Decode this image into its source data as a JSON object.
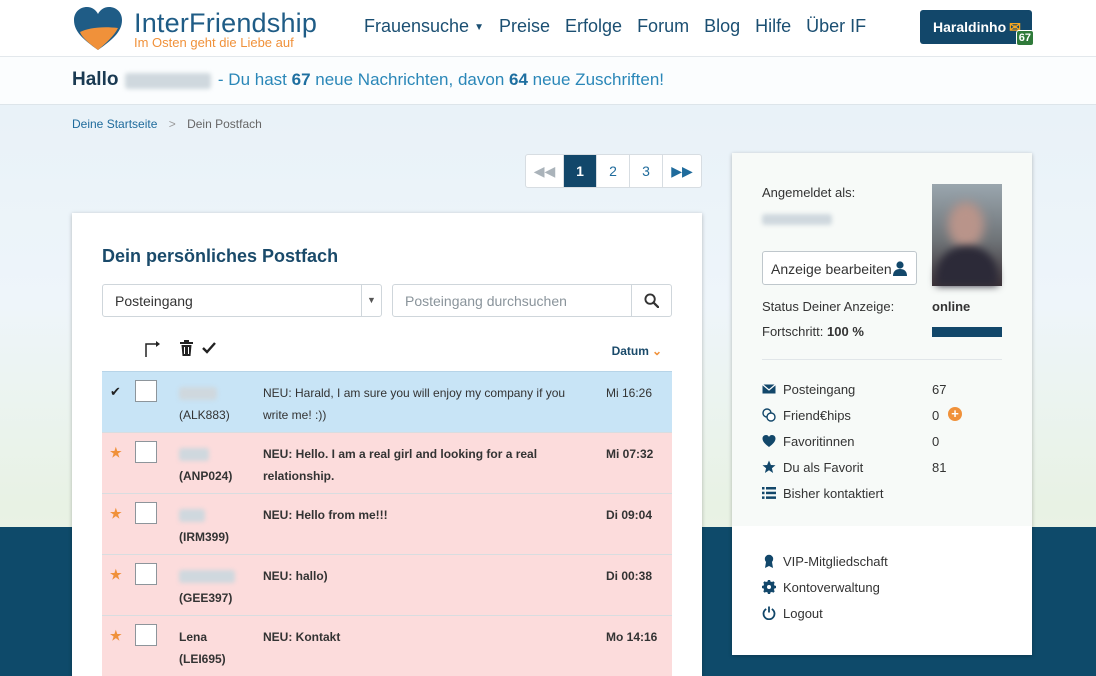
{
  "header": {
    "brand_name": "InterFriendship",
    "tagline": "Im Osten geht die Liebe auf",
    "nav": [
      {
        "label": "Frauensuche",
        "has_dropdown": true
      },
      {
        "label": "Preise"
      },
      {
        "label": "Erfolge"
      },
      {
        "label": "Forum"
      },
      {
        "label": "Blog"
      },
      {
        "label": "Hilfe"
      },
      {
        "label": "Über IF"
      }
    ],
    "user_button": {
      "label": "Haraldinho",
      "badge": "67"
    }
  },
  "greeting": {
    "hallo": "Hallo",
    "text_1": " - Du hast ",
    "messages": "67",
    "text_2": " neue Nachrichten, davon ",
    "replies": "64",
    "text_3": " neue Zuschriften!"
  },
  "breadcrumb": {
    "home": "Deine Startseite",
    "separator": ">",
    "current": "Dein Postfach"
  },
  "pagination": {
    "pages": [
      "1",
      "2",
      "3"
    ],
    "current": "1"
  },
  "mailbox": {
    "title": "Dein persönliches Postfach",
    "folder_selected": "Posteingang",
    "search_placeholder": "Posteingang durchsuchen",
    "date_header": "Datum",
    "messages": [
      {
        "status": "checked",
        "name": "",
        "code": "(ALK883)",
        "subject": "NEU: Harald, I am sure you will enjoy my company if you write me! :))",
        "date": "Mi 16:26",
        "unread": false
      },
      {
        "status": "star",
        "name": "",
        "code": "(ANP024)",
        "subject": "NEU: Hello. I am a real girl and looking for a real relationship.",
        "date": "Mi 07:32",
        "unread": true
      },
      {
        "status": "star",
        "name": "",
        "code": "(IRM399)",
        "subject": "NEU: Hello from me!!!",
        "date": "Di 09:04",
        "unread": true
      },
      {
        "status": "star",
        "name": "",
        "code": "(GEE397)",
        "subject": "NEU: hallo)",
        "date": "Di 00:38",
        "unread": true
      },
      {
        "status": "star",
        "name": "Lena",
        "code": "(LEI695)",
        "subject": "NEU: Kontakt",
        "date": "Mo 14:16",
        "unread": true
      }
    ]
  },
  "profile": {
    "logged_in_label": "Angemeldet als:",
    "edit_button": "Anzeige bearbeiten",
    "status_label": "Status Deiner Anzeige:",
    "status_value": "online",
    "progress_label": "Fortschritt:",
    "progress_value": "100 %",
    "progress_fraction": 1.0,
    "stats": [
      {
        "icon": "envelope-icon",
        "label": "Posteingang",
        "value": "67"
      },
      {
        "icon": "coins-icon",
        "label": "Friend€hips",
        "value": "0"
      },
      {
        "icon": "heart-icon",
        "label": "Favoritinnen",
        "value": "0"
      },
      {
        "icon": "star-icon",
        "label": "Du als Favorit",
        "value": "81"
      },
      {
        "icon": "list-icon",
        "label": "Bisher kontaktiert",
        "value": ""
      }
    ],
    "links": [
      {
        "icon": "award-icon",
        "label": "VIP-Mitgliedschaft"
      },
      {
        "icon": "gear-icon",
        "label": "Kontoverwaltung"
      },
      {
        "icon": "power-icon",
        "label": "Logout"
      }
    ]
  },
  "colors": {
    "primary": "#12476a",
    "accent": "#f0913a",
    "unread_row": "#fcdcdc",
    "selected_row": "#c8e4f6",
    "link": "#1f6b9c"
  }
}
